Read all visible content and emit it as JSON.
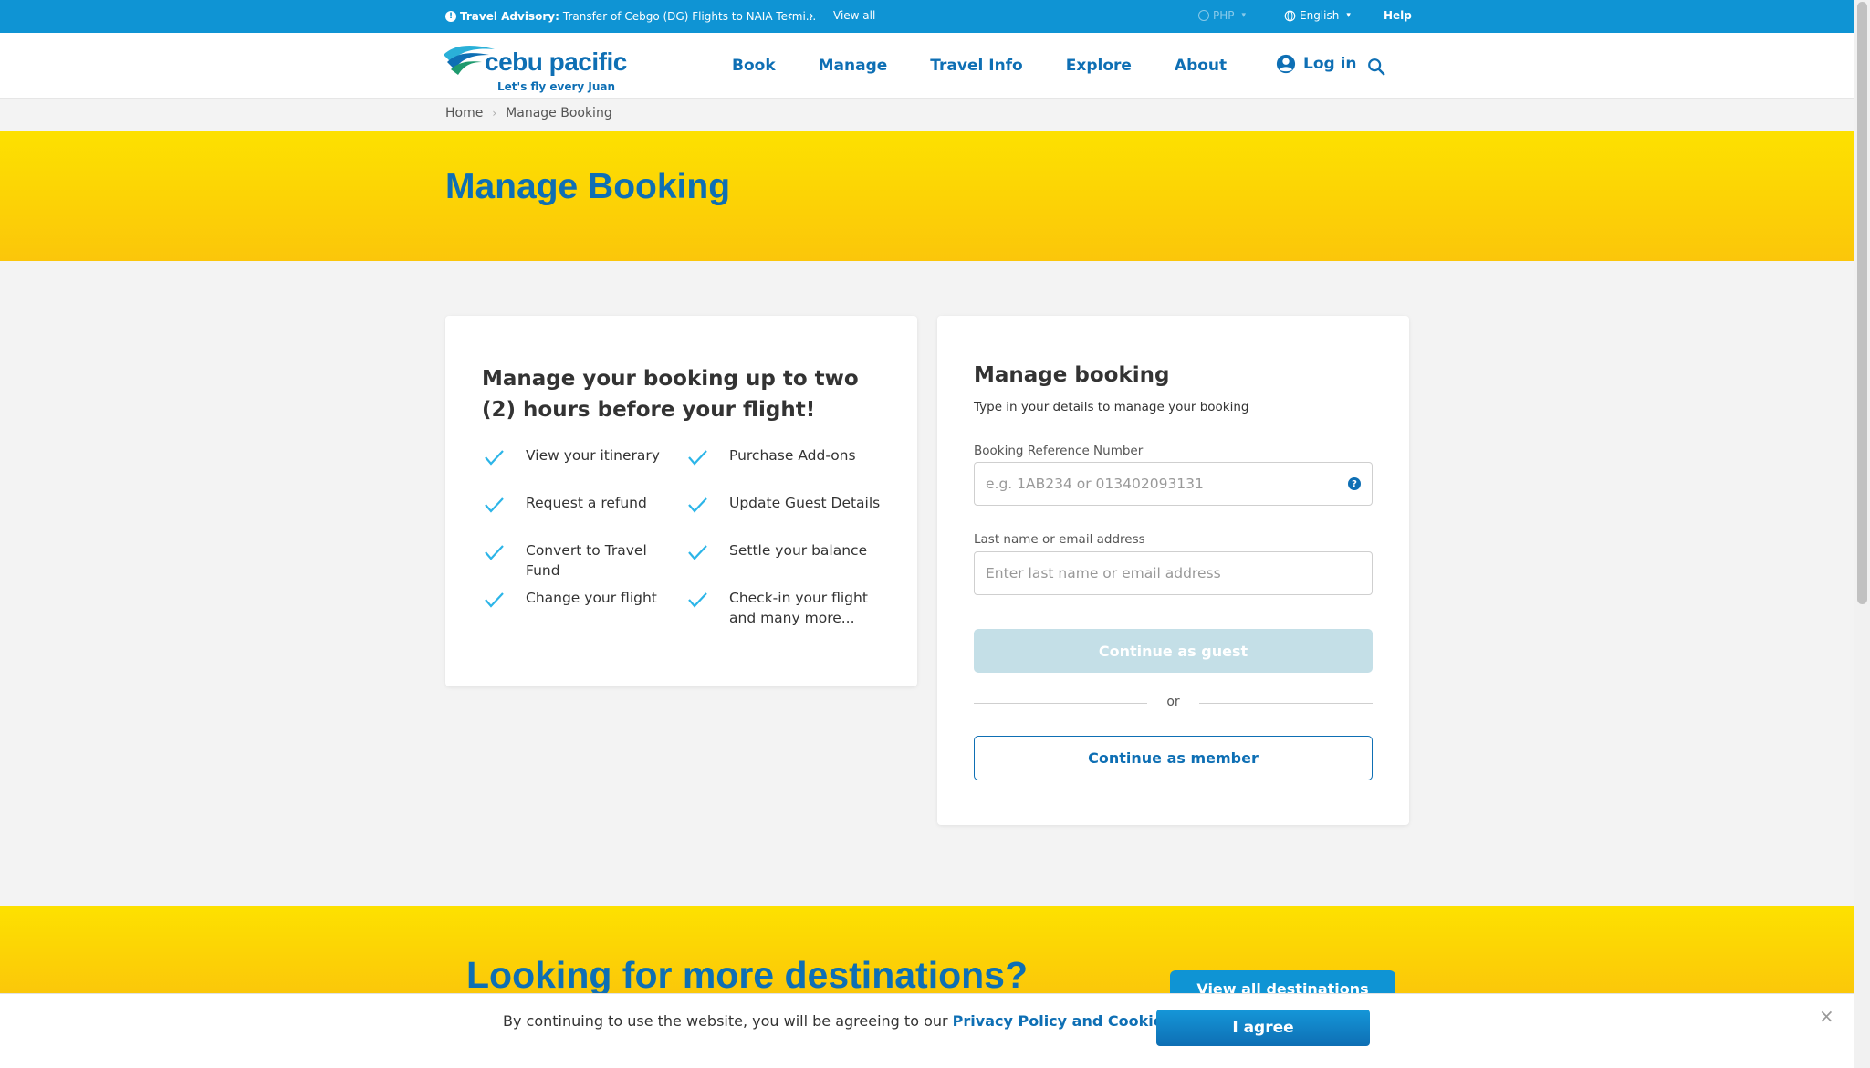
{
  "topbar": {
    "advisory_label": "Travel Advisory:",
    "advisory_text": "Transfer of Cebgo (DG) Flights to NAIA Termi...",
    "prev_arrow": "‹",
    "next_arrow": "›",
    "view_all": "View all",
    "currency": "PHP",
    "language": "English",
    "help": "Help"
  },
  "header": {
    "brand": "cebu pacific",
    "tagline": "Let's fly every Juan",
    "nav": [
      "Book",
      "Manage",
      "Travel Info",
      "Explore",
      "About"
    ],
    "login": "Log in"
  },
  "breadcrumb": {
    "home": "Home",
    "current": "Manage Booking"
  },
  "hero": {
    "title": "Manage Booking"
  },
  "benefits_card": {
    "title": "Manage your booking up to two (2) hours before your flight!",
    "items": [
      "View your itinerary",
      "Purchase Add-ons",
      "Request a refund",
      "Update Guest Details",
      "Convert to Travel Fund",
      "Settle your balance",
      "Change your flight",
      "Check-in your flight and many more..."
    ]
  },
  "form": {
    "title": "Manage booking",
    "subtitle": "Type in your details to manage your booking",
    "booking_ref_label": "Booking Reference Number",
    "booking_ref_placeholder": "e.g. 1AB234 or 013402093131",
    "booking_ref_value": "",
    "lastname_label": "Last name or email address",
    "lastname_placeholder": "Enter last name or email address",
    "lastname_value": "",
    "guest_button": "Continue as guest",
    "or": "or",
    "member_button": "Continue as member"
  },
  "destinations": {
    "title": "Looking for more destinations?",
    "button": "View all destinations"
  },
  "cookie": {
    "message": "By continuing to use the website, you will be agreeing to our",
    "link": "Privacy Policy and Cookie Policy",
    "agree": "I agree",
    "close": "×"
  },
  "colors": {
    "brand_blue": "#0e6fb4",
    "topbar_blue": "#0f94d4",
    "yellow": "#fde100",
    "check_cyan": "#2cb5e8",
    "disabled_button": "#c4dfe7"
  },
  "icons": {
    "advisory": "info-icon",
    "currency": "currency-icon",
    "language": "globe-icon",
    "login": "user-circle-icon",
    "search": "search-icon",
    "benefit": "check-icon",
    "field_help": "question-icon",
    "cookie_close": "close-icon"
  }
}
